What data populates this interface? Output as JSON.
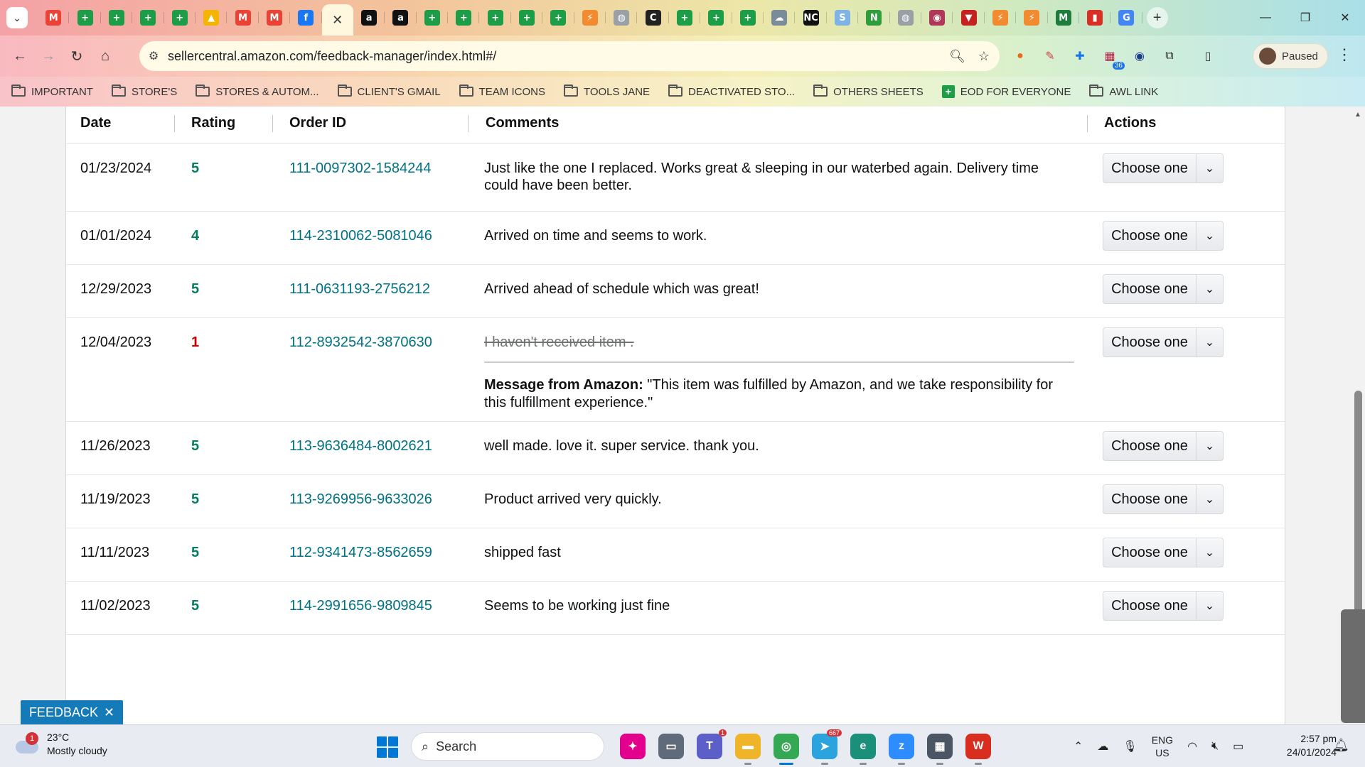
{
  "browser": {
    "url": "sellercentral.amazon.com/feedback-manager/index.html#/",
    "profile_label": "Paused",
    "tabs": [
      {
        "icon": "gmail-icon",
        "glyph": "M",
        "color": "#ea4335"
      },
      {
        "icon": "sheets-icon",
        "glyph": "+",
        "color": "#1e9d48"
      },
      {
        "icon": "sheets-icon",
        "glyph": "+",
        "color": "#1e9d48"
      },
      {
        "icon": "sheets-icon",
        "glyph": "+",
        "color": "#1e9d48"
      },
      {
        "icon": "sheets-icon",
        "glyph": "+",
        "color": "#1e9d48"
      },
      {
        "icon": "drive-icon",
        "glyph": "▲",
        "color": "#f4b400"
      },
      {
        "icon": "gmail-icon",
        "glyph": "M",
        "color": "#ea4335"
      },
      {
        "icon": "gmail-icon",
        "glyph": "M",
        "color": "#ea4335"
      },
      {
        "icon": "facebook-icon",
        "glyph": "f",
        "color": "#1877f2"
      },
      {
        "icon": "close-icon",
        "glyph": "✕",
        "color": "#333333",
        "active": true
      },
      {
        "icon": "amazon-icon",
        "glyph": "a",
        "color": "#111111"
      },
      {
        "icon": "amazon-icon",
        "glyph": "a",
        "color": "#111111"
      },
      {
        "icon": "sheets-icon",
        "glyph": "+",
        "color": "#1e9d48"
      },
      {
        "icon": "sheets-icon",
        "glyph": "+",
        "color": "#1e9d48"
      },
      {
        "icon": "sheets-icon",
        "glyph": "+",
        "color": "#1e9d48"
      },
      {
        "icon": "sheets-icon",
        "glyph": "+",
        "color": "#1e9d48"
      },
      {
        "icon": "sheets-icon",
        "glyph": "+",
        "color": "#1e9d48"
      },
      {
        "icon": "clickup-icon",
        "glyph": "⚡",
        "color": "#f28b30"
      },
      {
        "icon": "globe-icon",
        "glyph": "◍",
        "color": "#9aa0a6"
      },
      {
        "icon": "c-icon",
        "glyph": "C",
        "color": "#222222"
      },
      {
        "icon": "sheets-icon",
        "glyph": "+",
        "color": "#1e9d48"
      },
      {
        "icon": "sheets-icon",
        "glyph": "+",
        "color": "#1e9d48"
      },
      {
        "icon": "sheets-icon",
        "glyph": "+",
        "color": "#1e9d48"
      },
      {
        "icon": "cloud-icon",
        "glyph": "☁",
        "color": "#7a8b99"
      },
      {
        "icon": "nc-icon",
        "glyph": "NC",
        "color": "#111111"
      },
      {
        "icon": "sysco-icon",
        "glyph": "S",
        "color": "#7fb2e5"
      },
      {
        "icon": "n-icon",
        "glyph": "N",
        "color": "#2e9d3a"
      },
      {
        "icon": "globe-icon",
        "glyph": "◍",
        "color": "#9aa0a6"
      },
      {
        "icon": "circle-logo-icon",
        "glyph": "◉",
        "color": "#b0365a"
      },
      {
        "icon": "triangle-icon",
        "glyph": "▼",
        "color": "#c5221f"
      },
      {
        "icon": "clickup-icon",
        "glyph": "⚡",
        "color": "#f28b30"
      },
      {
        "icon": "clickup-icon",
        "glyph": "⚡",
        "color": "#f28b30"
      },
      {
        "icon": "m-icon",
        "glyph": "M",
        "color": "#1e7d3a"
      },
      {
        "icon": "red-doc-icon",
        "glyph": "▮",
        "color": "#d93025"
      },
      {
        "icon": "google-icon",
        "glyph": "G",
        "color": "#4285f4"
      }
    ]
  },
  "bookmarks": [
    {
      "label": "IMPORTANT",
      "icon": "folder-icon"
    },
    {
      "label": "STORE'S",
      "icon": "folder-icon"
    },
    {
      "label": "STORES & AUTOM...",
      "icon": "folder-icon"
    },
    {
      "label": "CLIENT'S GMAIL",
      "icon": "folder-icon"
    },
    {
      "label": "TEAM ICONS",
      "icon": "folder-icon"
    },
    {
      "label": "TOOLS JANE",
      "icon": "folder-icon"
    },
    {
      "label": "DEACTIVATED STO...",
      "icon": "folder-icon"
    },
    {
      "label": "OTHERS SHEETS",
      "icon": "folder-icon"
    },
    {
      "label": "EOD FOR EVERYONE",
      "icon": "sheets-icon"
    },
    {
      "label": "AWL LINK",
      "icon": "folder-icon"
    }
  ],
  "table": {
    "headers": {
      "date": "Date",
      "rating": "Rating",
      "order": "Order ID",
      "comments": "Comments",
      "actions": "Actions"
    },
    "action_label": "Choose one",
    "rows": [
      {
        "date": "01/23/2024",
        "rating": "5",
        "order_id": "111-0097302-1584244",
        "comment": "Just like the one I replaced. Works great & sleeping in our waterbed again. Delivery time could have been better."
      },
      {
        "date": "01/01/2024",
        "rating": "4",
        "order_id": "114-2310062-5081046",
        "comment": "Arrived on time and seems to work."
      },
      {
        "date": "12/29/2023",
        "rating": "5",
        "order_id": "111-0631193-2756212",
        "comment": "Arrived ahead of schedule which was great!"
      },
      {
        "date": "12/04/2023",
        "rating": "1",
        "order_id": "112-8932542-3870630",
        "comment": "I haven't received item .",
        "struck": true,
        "amazon_message_label": "Message from Amazon:",
        "amazon_message": " \"This item was fulfilled by Amazon, and we take responsibility for this fulfillment experience.\""
      },
      {
        "date": "11/26/2023",
        "rating": "5",
        "order_id": "113-9636484-8002621",
        "comment": "well made. love it. super service. thank you."
      },
      {
        "date": "11/19/2023",
        "rating": "5",
        "order_id": "113-9269956-9633026",
        "comment": "Product arrived very quickly."
      },
      {
        "date": "11/11/2023",
        "rating": "5",
        "order_id": "112-9341473-8562659",
        "comment": "shipped fast"
      },
      {
        "date": "11/02/2023",
        "rating": "5",
        "order_id": "114-2991656-9809845",
        "comment": "Seems to be working just fine"
      }
    ]
  },
  "feedback_tab": {
    "label": "FEEDBACK"
  },
  "taskbar": {
    "weather_temp": "23°C",
    "weather_desc": "Mostly cloudy",
    "weather_badge": "1",
    "search_label": "Search",
    "apps": [
      {
        "icon": "copilot-icon",
        "glyph": "✦",
        "color": "#e3008c"
      },
      {
        "icon": "desktop-icon",
        "glyph": "▭",
        "color": "#5f6b7a"
      },
      {
        "icon": "teams-icon",
        "glyph": "T",
        "color": "#5b5fc7",
        "badge": "1"
      },
      {
        "icon": "file-explorer-icon",
        "glyph": "▬",
        "color": "#f0b429",
        "running": true
      },
      {
        "icon": "chrome-icon",
        "glyph": "◎",
        "color": "#34a853",
        "running": true,
        "current": true
      },
      {
        "icon": "telegram-icon",
        "glyph": "➤",
        "color": "#2aa3de",
        "badge": "667",
        "running": true
      },
      {
        "icon": "edge-icon",
        "glyph": "e",
        "color": "#1a8f7a",
        "running": true
      },
      {
        "icon": "zoom-icon",
        "glyph": "z",
        "color": "#2d8cff",
        "running": true
      },
      {
        "icon": "calculator-icon",
        "glyph": "▦",
        "color": "#4b5563",
        "running": true
      },
      {
        "icon": "wps-icon",
        "glyph": "W",
        "color": "#d92d20",
        "running": true
      }
    ],
    "lang_top": "ENG",
    "lang_bottom": "US",
    "time": "2:57 pm",
    "date": "24/01/2024"
  }
}
